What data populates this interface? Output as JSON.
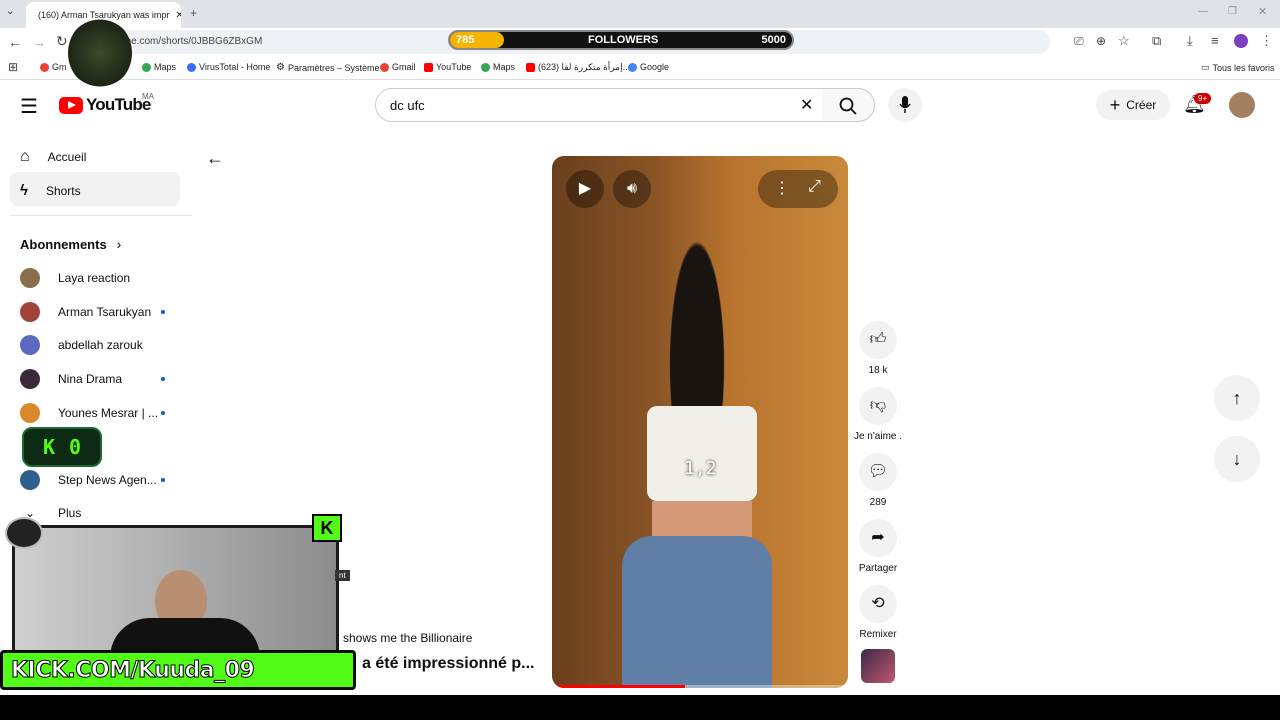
{
  "browser": {
    "tab_title": "(160) Arman Tsarukyan was impr",
    "url": "ube.com/shorts/0JBBG6ZBxGM",
    "bookmarks": [
      {
        "label": "Gm"
      },
      {
        "label": "Maps"
      },
      {
        "label": "VirusTotal - Home"
      },
      {
        "label": "Paramètres – Système"
      },
      {
        "label": "Gmail"
      },
      {
        "label": "YouTube"
      },
      {
        "label": "Maps"
      },
      {
        "label": "(623) إمرأة متكررة لقا..."
      },
      {
        "label": "Google"
      }
    ],
    "all_bookmarks": "Tous les favoris"
  },
  "overlay": {
    "followers_current": "785",
    "followers_label": "FOLLOWERS",
    "followers_goal": "5000",
    "followers_progress": 0.157,
    "k0_letter": "K",
    "k0_count": "0",
    "webcam_tag": "nt",
    "kick_banner": "KICK.COM/Kuuda_09"
  },
  "youtube": {
    "country": "MA",
    "search_value": "dc ufc",
    "create_label": "Créer",
    "notif_badge": "9+",
    "sidebar": {
      "home": "Accueil",
      "shorts": "Shorts",
      "subscriptions_heading": "Abonnements",
      "channels": [
        {
          "name": "Laya reaction",
          "new": false,
          "color": "#8a6d4a"
        },
        {
          "name": "Arman Tsarukyan",
          "new": true,
          "color": "#a0433a"
        },
        {
          "name": "abdellah zarouk",
          "new": false,
          "color": "#5b6abf"
        },
        {
          "name": "Nina Drama",
          "new": true,
          "color": "#3a2a3a"
        },
        {
          "name": "Younes Mesrar | ...",
          "new": true,
          "color": "#d9892b"
        },
        {
          "name": "Step News Agen...",
          "new": true,
          "color": "#2f5f8f"
        }
      ],
      "more": "Plus"
    },
    "short": {
      "overlay_text": "1,2",
      "caption_top": "shows me the Billionaire",
      "caption_title": "a été impressionné p...",
      "likes": "18 k",
      "dislike_label": "Je n'aime .",
      "comments": "289",
      "share_label": "Partager",
      "remix_label": "Remixer",
      "progress": 0.45
    }
  }
}
